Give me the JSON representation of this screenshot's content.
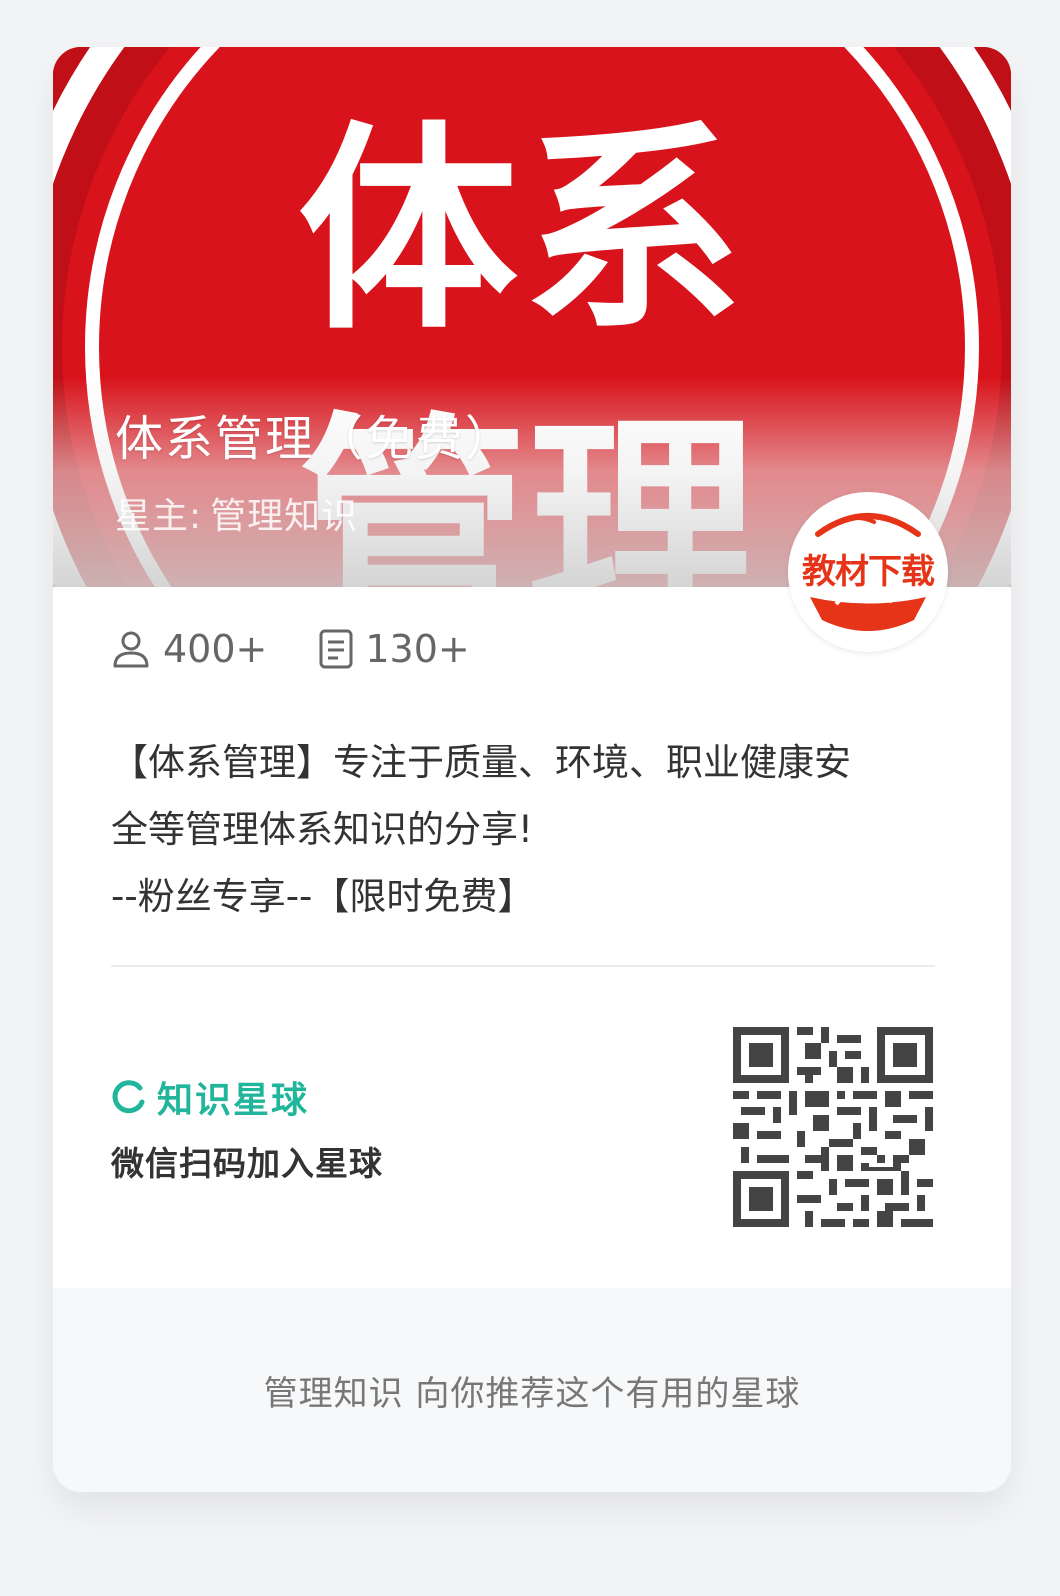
{
  "banner": {
    "image_text": [
      "体",
      "系",
      "管",
      "理"
    ],
    "title": "体系管理（免费）",
    "owner_label": "星主:",
    "owner_name": "管理知识"
  },
  "badge": {
    "text": "教材下载"
  },
  "stats": {
    "members": "400+",
    "posts": "130+"
  },
  "description": {
    "lines": [
      "【体系管理】专注于质量、环境、职业健康安",
      "全等管理体系知识的分享!",
      "--粉丝专享--【限时免费】"
    ]
  },
  "brand": {
    "name": "知识星球",
    "scan_tip": "微信扫码加入星球"
  },
  "footer": {
    "text": "管理知识 向你推荐这个有用的星球"
  },
  "colors": {
    "banner_red": "#c00f16",
    "brand_green": "#21b59c",
    "badge_red": "#e53418"
  },
  "icons": [
    "user-icon",
    "document-icon",
    "planet-logo-icon",
    "qr-code"
  ]
}
